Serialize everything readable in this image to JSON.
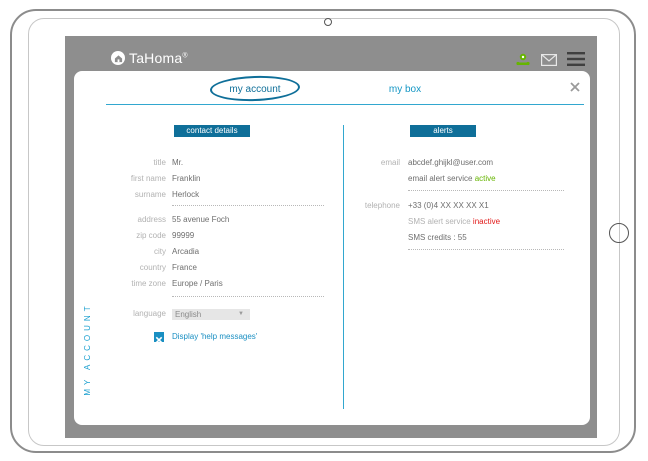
{
  "app": {
    "name": "TaHoma",
    "trademark": "®"
  },
  "colors": {
    "accent": "#0f6f99",
    "link": "#1496c4",
    "active": "#66b500",
    "inactive": "#e11818"
  },
  "icons": {
    "logo": "house-icon",
    "top_bar": [
      "user-avatar-icon",
      "mail-icon",
      "menu-icon"
    ],
    "close": "close-icon",
    "checkbox": "checkbox-checked-icon"
  },
  "tabs": [
    {
      "label": "my account",
      "active": true
    },
    {
      "label": "my box",
      "active": false
    }
  ],
  "side_label": "MY ACCOUNT",
  "contact": {
    "header": "contact details",
    "fields": [
      {
        "label": "title",
        "value": "Mr."
      },
      {
        "label": "first name",
        "value": "Franklin"
      },
      {
        "label": "surname",
        "value": "Herlock"
      },
      {
        "label": "address",
        "value": "55 avenue Foch"
      },
      {
        "label": "zip code",
        "value": "99999"
      },
      {
        "label": "city",
        "value": "Arcadia"
      },
      {
        "label": "country",
        "value": "France"
      },
      {
        "label": "time zone",
        "value": "Europe / Paris"
      }
    ],
    "language": {
      "label": "language",
      "value": "English"
    },
    "help_messages": {
      "label": "Display 'help messages'",
      "checked": true
    }
  },
  "alerts": {
    "header": "alerts",
    "email": {
      "label": "email",
      "value": "abcdef.ghijkl@user.com",
      "service_text": "email alert service",
      "service_status": "active"
    },
    "telephone": {
      "label": "telephone",
      "value": "+33 (0)4 XX XX XX X1",
      "service_text": "SMS alert service",
      "service_status": "inactive",
      "credits": "SMS credits : 55"
    }
  }
}
